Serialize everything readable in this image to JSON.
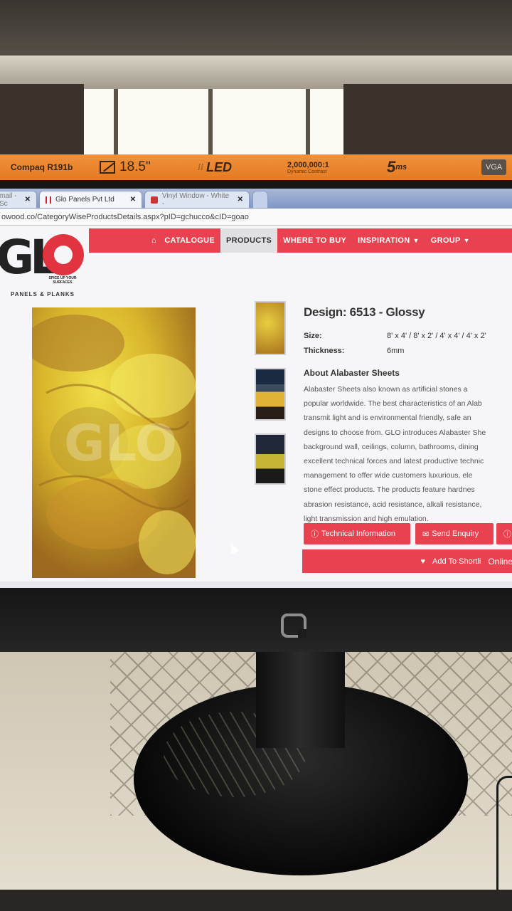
{
  "monitor_label": {
    "brand": "Compaq R191b",
    "screen_size": "18.5\"",
    "panel_type": "LED",
    "contrast_value": "2,000,000:1",
    "contrast_caption": "Dynamic Contrast",
    "response_time": "5",
    "response_unit": "ms",
    "port": "VGA"
  },
  "browser": {
    "tabs": [
      {
        "label": "mail - Sc",
        "active": false
      },
      {
        "label": "Glo Panels Pvt Ltd",
        "active": true
      },
      {
        "label": "Vinyl Window - White -",
        "active": false
      }
    ],
    "url": "owood.co/CategoryWiseProductsDetails.aspx?pID=gchucco&cID=goao"
  },
  "site": {
    "logo_text": "GLO",
    "logo_tagline": "SPICE UP YOUR SURFACES",
    "logo_sub": "PANELS & PLANKS",
    "nav": [
      {
        "label": "CATALOGUE",
        "active": false,
        "dropdown": false
      },
      {
        "label": "PRODUCTS",
        "active": true,
        "dropdown": false
      },
      {
        "label": "WHERE TO BUY",
        "active": false,
        "dropdown": false
      },
      {
        "label": "INSPIRATION",
        "active": false,
        "dropdown": true
      },
      {
        "label": "GROUP",
        "active": false,
        "dropdown": true
      }
    ],
    "product": {
      "design": "Design: 6513 - Glossy",
      "size_label": "Size:",
      "size_value": "8' x 4' / 8' x 2' / 4' x 4' / 4' x 2'",
      "thickness_label": "Thickness:",
      "thickness_value": "6mm",
      "about_heading": "About Alabaster Sheets",
      "about_lines": [
        "Alabaster Sheets also known as artificial stones a",
        "popular worldwide. The best characteristics of an Alab",
        "transmit light and is environmental friendly, safe an",
        "designs to choose from. GLO introduces Alabaster She",
        "background wall, ceilings, column, bathrooms, dining",
        "excellent technical forces and latest productive technic",
        "management to offer wide customers luxurious, ele",
        "stone effect products. The products feature hardnes",
        "abrasion resistance, acid resistance, alkali resistance,",
        "light transmission and high emulation."
      ]
    },
    "buttons": {
      "technical": "Technical Information",
      "enquiry": "Send Enquiry",
      "shortlist": "Add To Shortli",
      "online": "Online"
    }
  },
  "colors": {
    "brand_red": "#e8414f",
    "label_orange": "#ec8630"
  }
}
